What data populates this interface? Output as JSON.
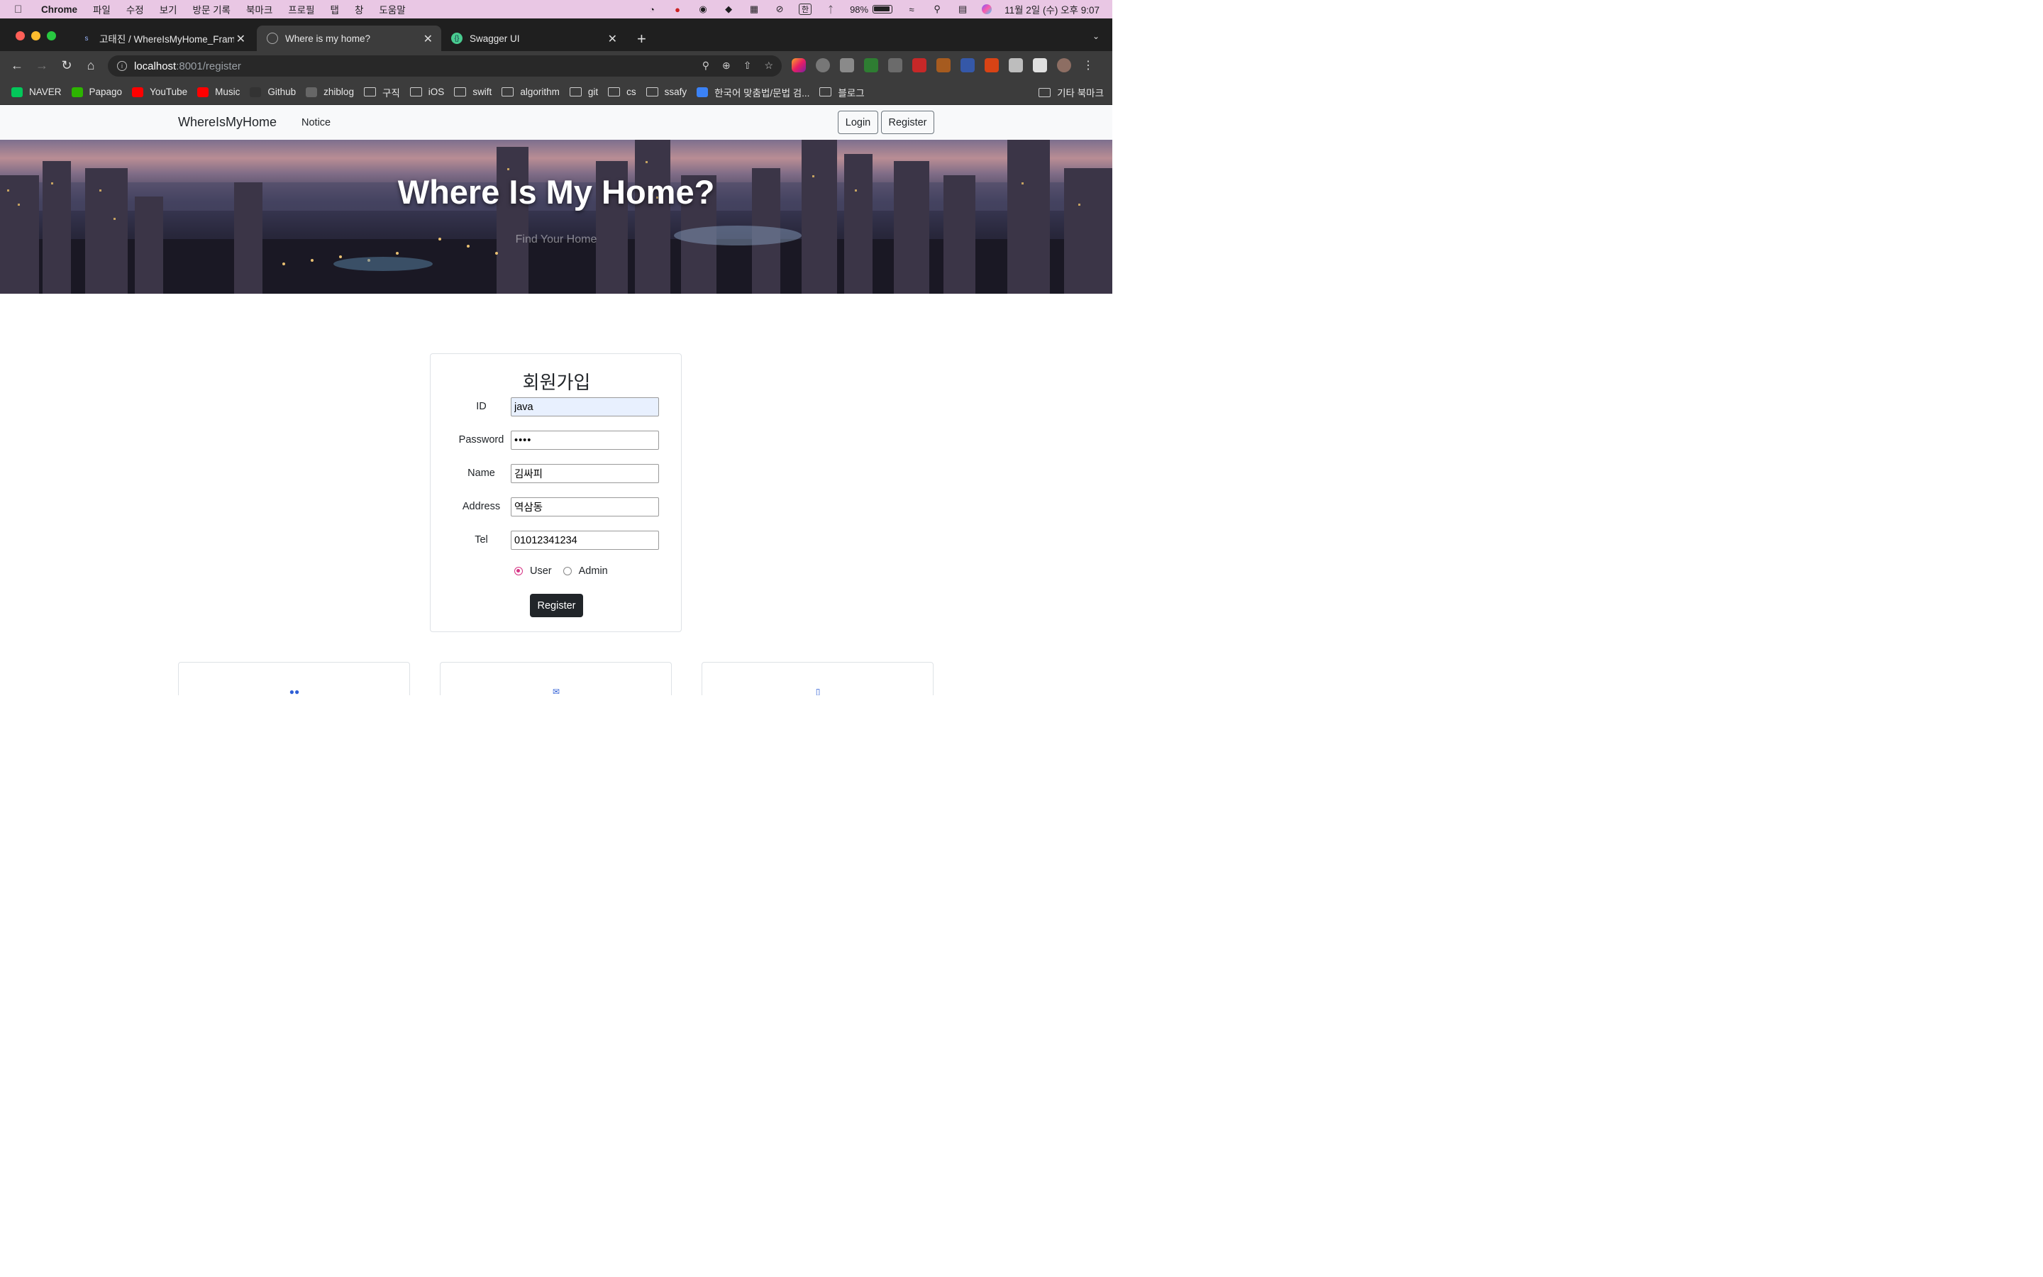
{
  "menubar": {
    "app": "Chrome",
    "items": [
      "파일",
      "수정",
      "보기",
      "방문 기록",
      "북마크",
      "프로필",
      "탭",
      "창",
      "도움말"
    ],
    "battery": "98%",
    "datetime": "11월 2일 (수) 오후 9:07",
    "ime": "한"
  },
  "tabs": [
    {
      "title": "고태진 / WhereIsMyHome_Fram",
      "active": false
    },
    {
      "title": "Where is my home?",
      "active": true
    },
    {
      "title": "Swagger UI",
      "active": false
    }
  ],
  "address": {
    "host": "localhost",
    "rest": ":8001/register"
  },
  "bookmarks": [
    {
      "label": "NAVER",
      "type": "site",
      "color": "#03c75a"
    },
    {
      "label": "Papago",
      "type": "site",
      "color": "#2db400"
    },
    {
      "label": "YouTube",
      "type": "site",
      "color": "#ff0000"
    },
    {
      "label": "Music",
      "type": "site",
      "color": "#ff0000"
    },
    {
      "label": "Github",
      "type": "site",
      "color": "#333333"
    },
    {
      "label": "zhiblog",
      "type": "site",
      "color": "#666666"
    },
    {
      "label": "구직",
      "type": "folder"
    },
    {
      "label": "iOS",
      "type": "folder"
    },
    {
      "label": "swift",
      "type": "folder"
    },
    {
      "label": "algorithm",
      "type": "folder"
    },
    {
      "label": "git",
      "type": "folder"
    },
    {
      "label": "cs",
      "type": "folder"
    },
    {
      "label": "ssafy",
      "type": "folder"
    },
    {
      "label": "한국어 맞춤법/문법 검...",
      "type": "site",
      "color": "#3b82f6"
    },
    {
      "label": "블로그",
      "type": "folder"
    }
  ],
  "other_bookmarks": "기타 북마크",
  "site": {
    "brand": "WhereIsMyHome",
    "nav": "Notice",
    "login": "Login",
    "register": "Register",
    "hero_title": "Where Is My Home?",
    "hero_subtitle": "Find Your Home"
  },
  "form": {
    "title": "회원가입",
    "fields": [
      {
        "label": "ID",
        "value": "java"
      },
      {
        "label": "Password",
        "value": "••••"
      },
      {
        "label": "Name",
        "value": "김싸피"
      },
      {
        "label": "Address",
        "value": "역삼동"
      },
      {
        "label": "Tel",
        "value": "01012341234"
      }
    ],
    "role_user": "User",
    "role_admin": "Admin",
    "selected_role": "User",
    "submit": "Register"
  },
  "colors": {
    "accent": "#d63384",
    "dark_button": "#212529",
    "icon_blue": "#2f5fd6"
  }
}
